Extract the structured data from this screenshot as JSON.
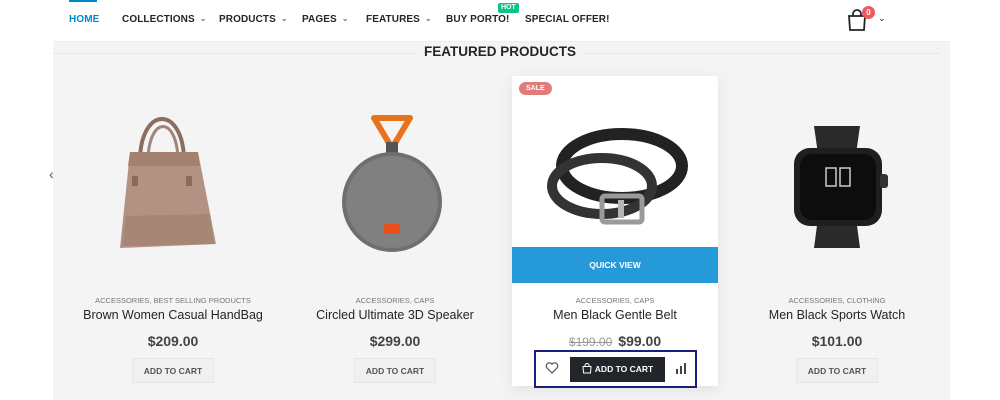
{
  "nav": {
    "items": [
      {
        "label": "HOME",
        "chevron": false
      },
      {
        "label": "COLLECTIONS",
        "chevron": true
      },
      {
        "label": "PRODUCTS",
        "chevron": true
      },
      {
        "label": "PAGES",
        "chevron": true
      },
      {
        "label": "FEATURES",
        "chevron": true
      },
      {
        "label": "BUY PORTO!",
        "chevron": false
      },
      {
        "label": "SPECIAL OFFER!",
        "chevron": false
      }
    ],
    "hot_badge": "HOT",
    "cart_count": "0",
    "cart_icon": "shopping-bag-icon"
  },
  "section": {
    "title": "FEATURED PRODUCTS"
  },
  "products": [
    {
      "category": "ACCESSORIES, BEST SELLING PRODUCTS",
      "name": "Brown Women Casual HandBag",
      "price": "$209.00",
      "add_label": "ADD TO CART"
    },
    {
      "category": "ACCESSORIES, CAPS",
      "name": "Circled Ultimate 3D Speaker",
      "price": "$299.00",
      "add_label": "ADD TO CART"
    },
    {
      "category": "ACCESSORIES, CAPS",
      "name": "Men Black Gentle Belt",
      "old_price": "$199.00",
      "price": "$99.00",
      "add_label": "ADD TO CART",
      "badge": "SALE",
      "quick_view": "QUICK VIEW"
    },
    {
      "category": "ACCESSORIES, CLOTHING",
      "name": "Men Black Sports Watch",
      "price": "$101.00",
      "add_label": "ADD TO CART"
    }
  ],
  "colors": {
    "accent": "#0088cc",
    "quick_view": "#2699d9",
    "sale": "#e27c7c",
    "hot": "#0cc485",
    "highlight_border": "#1b1f7a"
  }
}
